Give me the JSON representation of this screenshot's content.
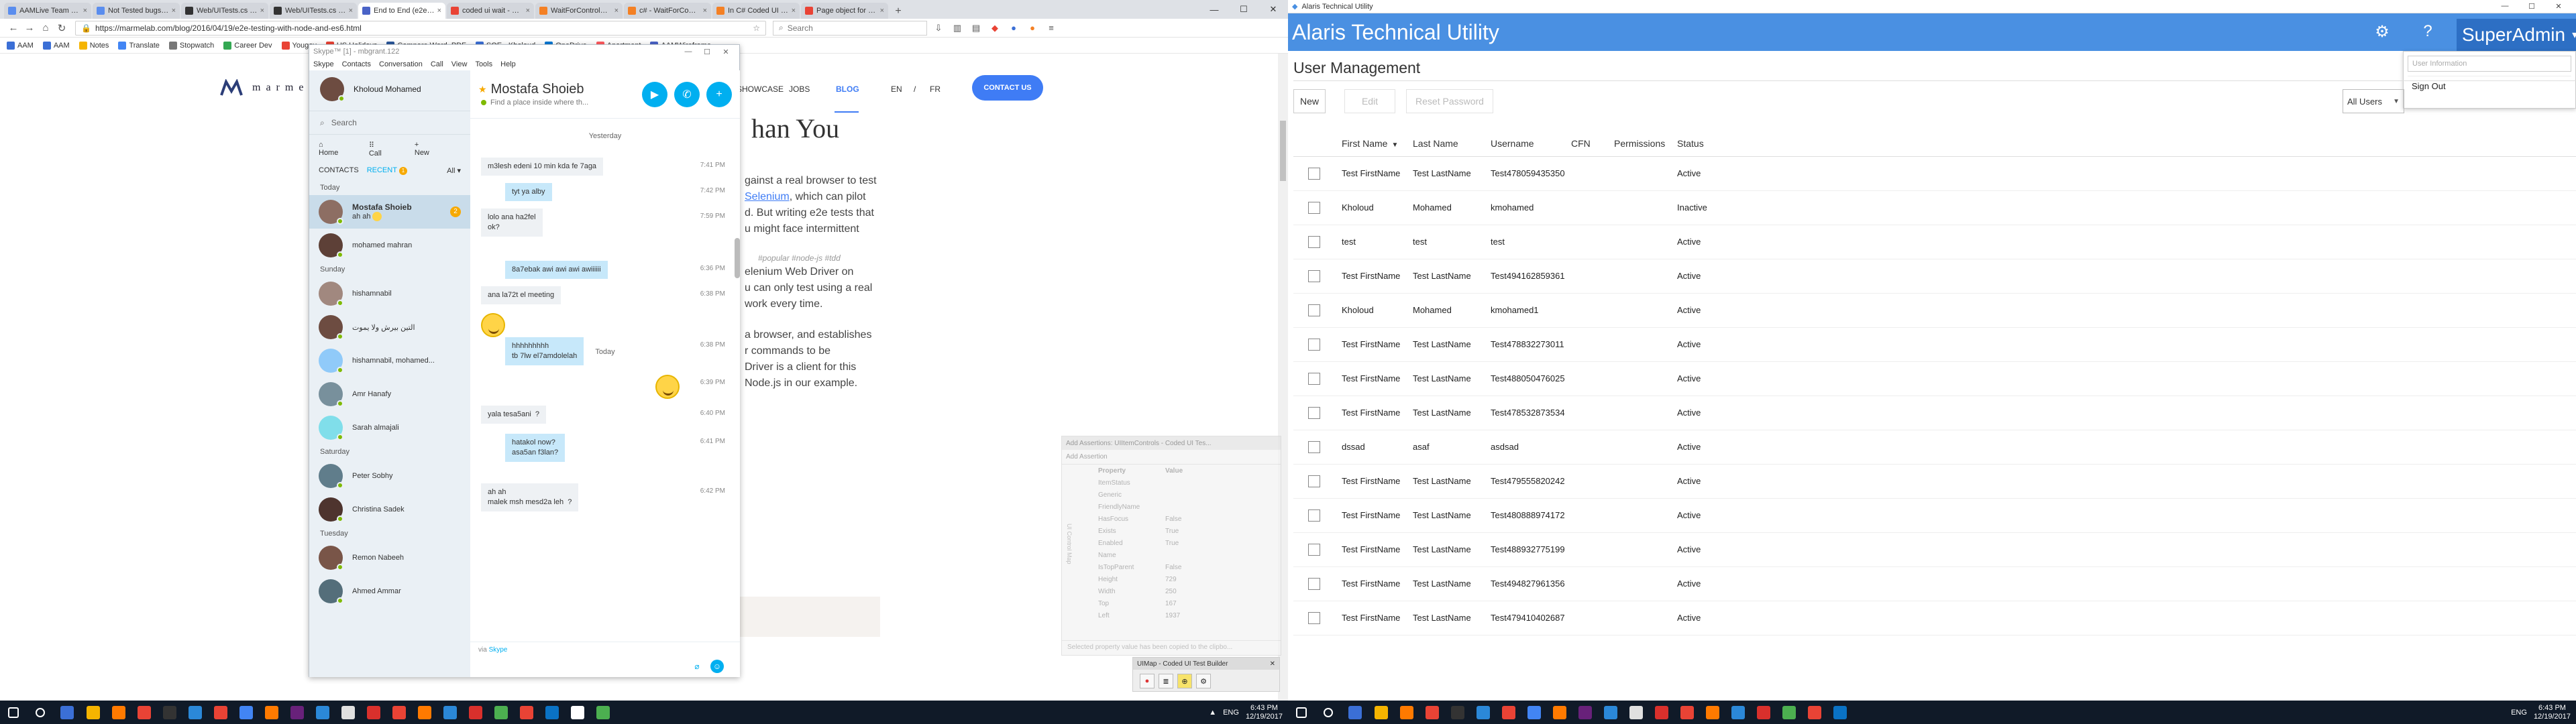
{
  "browser": {
    "tabs": [
      {
        "label": "AAMLive Team Spri",
        "color": "#5a8dee"
      },
      {
        "label": "Not Tested bugs to c",
        "color": "#5a8dee"
      },
      {
        "label": "Web/UITests.cs at n",
        "color": "#333333"
      },
      {
        "label": "Web/UITests.cs at n",
        "color": "#333333"
      },
      {
        "label": "End to End (e2e) Tes",
        "color": "#4a63c7",
        "active": true
      },
      {
        "label": "coded ui wait - Goo",
        "color": "#e94335"
      },
      {
        "label": "WaitForControlRea",
        "color": "#f48024"
      },
      {
        "label": "c# - WaitForContro",
        "color": "#f48024"
      },
      {
        "label": "In C# Coded UI is th",
        "color": "#f48024"
      },
      {
        "label": "Page object for testi",
        "color": "#e94335"
      }
    ],
    "url": "https://marmelab.com/blog/2016/04/19/e2e-testing-with-node-and-es6.html",
    "search_placeholder": "Search",
    "bookmarks": [
      {
        "label": "AAM",
        "color": "#3b6fd6"
      },
      {
        "label": "AAM",
        "color": "#3b6fd6"
      },
      {
        "label": "Notes",
        "color": "#f5b400"
      },
      {
        "label": "Translate",
        "color": "#4285f4"
      },
      {
        "label": "Stopwatch",
        "color": "#777777"
      },
      {
        "label": "Career Dev",
        "color": "#34a853"
      },
      {
        "label": "Yougov",
        "color": "#e94335"
      },
      {
        "label": "US Holidays",
        "color": "#e94335"
      },
      {
        "label": "Compare Word, PDF",
        "color": "#2b579a"
      },
      {
        "label": "SQE - Kholoud",
        "color": "#3b6fd6"
      },
      {
        "label": "OneDrive",
        "color": "#0078d4"
      },
      {
        "label": "Apartment",
        "color": "#ff5a5f"
      },
      {
        "label": "AAMWireframe",
        "color": "#4a63c7"
      }
    ]
  },
  "site": {
    "logo": "marmelab",
    "nav": [
      "SHOWCASE",
      "JOBS",
      "BLOG"
    ],
    "lang": [
      "EN",
      "/",
      "FR"
    ],
    "contact": "CONTACT US",
    "hero": "han You",
    "tags": "#popular  #node-js  #tdd",
    "lines": [
      {
        "pre": "gainst a real browser to test",
        "link": "",
        "post": ""
      },
      {
        "pre": "",
        "link": "Selenium",
        "post": ", which can pilot"
      },
      {
        "pre": "d. But writing e2e tests that",
        "link": "",
        "post": ""
      },
      {
        "pre": "u might face intermittent",
        "link": "",
        "post": ""
      },
      {
        "pre": "elenium Web Driver on",
        "link": "",
        "post": ""
      },
      {
        "pre": "u can only test using a real",
        "link": "",
        "post": ""
      },
      {
        "pre": "work every time.",
        "link": "",
        "post": ""
      },
      {
        "pre": "a browser, and establishes",
        "link": "",
        "post": ""
      },
      {
        "pre": "r commands to be",
        "link": "",
        "post": ""
      },
      {
        "pre": "Driver is a client for this",
        "link": "",
        "post": ""
      },
      {
        "pre": "Node.js in our example.",
        "link": "",
        "post": ""
      }
    ]
  },
  "skype": {
    "title": "Skype™ [1] - mbgrant.122",
    "menu": [
      "Skype",
      "Contacts",
      "Conversation",
      "Call",
      "View",
      "Tools",
      "Help"
    ],
    "me": "Kholoud Mohamed",
    "search": "Search",
    "actions": [
      "Home",
      "Call",
      "New"
    ],
    "filter": {
      "contacts": "CONTACTS",
      "recent": "RECENT",
      "recent_badge": "1",
      "all": "All"
    },
    "contacts": [
      {
        "group": "Today"
      },
      {
        "name": "Mostafa Shoieb",
        "sub": "ah ah",
        "selected": true,
        "badge": "2",
        "color": "#8d6e63"
      },
      {
        "name": "mohamed mahran",
        "color": "#5d4037"
      },
      {
        "group": "Sunday"
      },
      {
        "name": "hishamnabil",
        "color": "#a1887f"
      },
      {
        "name": "التين بيرش ولا يموت",
        "color": "#6d4c41"
      },
      {
        "name": "hishamnabil, mohamed...",
        "color": "#90caf9"
      },
      {
        "name": "Amr Hanafy",
        "color": "#78909c"
      },
      {
        "name": "Sarah almajali",
        "color": "#80deea"
      },
      {
        "group": "Saturday"
      },
      {
        "name": "Peter Sobhy",
        "color": "#607d8b"
      },
      {
        "name": "Christina Sadek",
        "color": "#4e342e"
      },
      {
        "group": "Tuesday"
      },
      {
        "name": "Remon Nabeeh",
        "color": "#795548"
      },
      {
        "name": "Ahmed Ammar",
        "color": "#546e7a"
      }
    ],
    "chat": {
      "name": "Mostafa Shoieb",
      "mood": "Find a place inside where th...",
      "yesterday": "Yesterday",
      "today": "Today",
      "messages": [
        {
          "dir": "in",
          "text": "m3lesh edeni 10 min kda fe 7aga",
          "time": "7:41 PM"
        },
        {
          "dir": "out",
          "text": "tyt ya alby",
          "time": "7:42 PM"
        },
        {
          "dir": "in",
          "text": "lolo ana ha2fel\nok?",
          "time": "7:59 PM"
        },
        {
          "dir": "out",
          "text": "8a7ebak awi awi awi awiiiiii",
          "time": "6:36 PM"
        },
        {
          "dir": "in",
          "text": "ana la72t el meeting",
          "time": "6:38 PM"
        },
        {
          "dir": "out",
          "text": "hhhhhhhhh\ntb 7lw el7amdolelah",
          "time": "6:38 PM"
        },
        {
          "dir": "out",
          "text": "",
          "time": "6:39 PM"
        },
        {
          "dir": "in",
          "text": "yala tesa5ani  ?",
          "time": "6:40 PM"
        },
        {
          "dir": "out",
          "text": "hatakol now?\nasa5an f3lan?",
          "time": "6:41 PM"
        },
        {
          "dir": "in",
          "text": "ah ah \nmalek msh mesd2a leh  ?",
          "time": "6:42 PM"
        }
      ],
      "via": "via",
      "via_link": "Skype"
    }
  },
  "codedui": {
    "panel_title": "Add Assertions: UIItemControls - Coded UI Tes...",
    "add_assertion": "Add Assertion",
    "col_property": "Property",
    "col_value": "Value",
    "properties": [
      {
        "k": "ItemStatus",
        "v": ""
      },
      {
        "k": "Generic",
        "v": ""
      },
      {
        "k": "FriendlyName",
        "v": ""
      },
      {
        "k": "HasFocus",
        "v": "False"
      },
      {
        "k": "Exists",
        "v": "True"
      },
      {
        "k": "Enabled",
        "v": "True"
      },
      {
        "k": "Name",
        "v": ""
      },
      {
        "k": "IsTopParent",
        "v": "False"
      },
      {
        "k": "Height",
        "v": "729"
      },
      {
        "k": "Width",
        "v": "250"
      },
      {
        "k": "Top",
        "v": "167"
      },
      {
        "k": "Left",
        "v": "1937"
      }
    ],
    "side_label": "UI Control Map",
    "footer": "Selected property value has been copied to the clipbo...",
    "builder_title": "UIMap - Coded UI Test Builder"
  },
  "taskbar_left": {
    "lang": "ENG",
    "time": "6:43 PM",
    "date": "12/19/2017"
  },
  "taskbar_right": {
    "lang": "ENG",
    "time": "6:43 PM",
    "date": "12/19/2017"
  },
  "app": {
    "window_title": "Alaris Technical Utility",
    "title": "Alaris Technical Utility",
    "user": "SuperAdmin",
    "dropdown": {
      "placeholder": "User Information",
      "signout": "Sign Out"
    },
    "section": "User Management",
    "buttons": {
      "new": "New",
      "edit": "Edit",
      "reset": "Reset Password"
    },
    "filter": "All Users",
    "columns": [
      "First Name",
      "Last Name",
      "Username",
      "CFN",
      "Permissions",
      "Status"
    ],
    "rows": [
      [
        "Test FirstName",
        "Test LastName",
        "Test478059435350",
        "",
        "",
        "Active"
      ],
      [
        "Kholoud",
        "Mohamed",
        "kmohamed",
        "",
        "",
        "Inactive"
      ],
      [
        "test",
        "test",
        "test",
        "",
        "",
        "Active"
      ],
      [
        "Test FirstName",
        "Test LastName",
        "Test494162859361",
        "",
        "",
        "Active"
      ],
      [
        "Kholoud",
        "Mohamed",
        "kmohamed1",
        "",
        "",
        "Active"
      ],
      [
        "Test FirstName",
        "Test LastName",
        "Test478832273011",
        "",
        "",
        "Active"
      ],
      [
        "Test FirstName",
        "Test LastName",
        "Test488050476025",
        "",
        "",
        "Active"
      ],
      [
        "Test FirstName",
        "Test LastName",
        "Test478532873534",
        "",
        "",
        "Active"
      ],
      [
        "dssad",
        "asaf",
        "asdsad",
        "",
        "",
        "Active"
      ],
      [
        "Test FirstName",
        "Test LastName",
        "Test479555820242",
        "",
        "",
        "Active"
      ],
      [
        "Test FirstName",
        "Test LastName",
        "Test480888974172",
        "",
        "",
        "Active"
      ],
      [
        "Test FirstName",
        "Test LastName",
        "Test488932775199",
        "",
        "",
        "Active"
      ],
      [
        "Test FirstName",
        "Test LastName",
        "Test494827961356",
        "",
        "",
        "Active"
      ],
      [
        "Test FirstName",
        "Test LastName",
        "Test479410402687",
        "",
        "",
        "Active"
      ]
    ]
  }
}
